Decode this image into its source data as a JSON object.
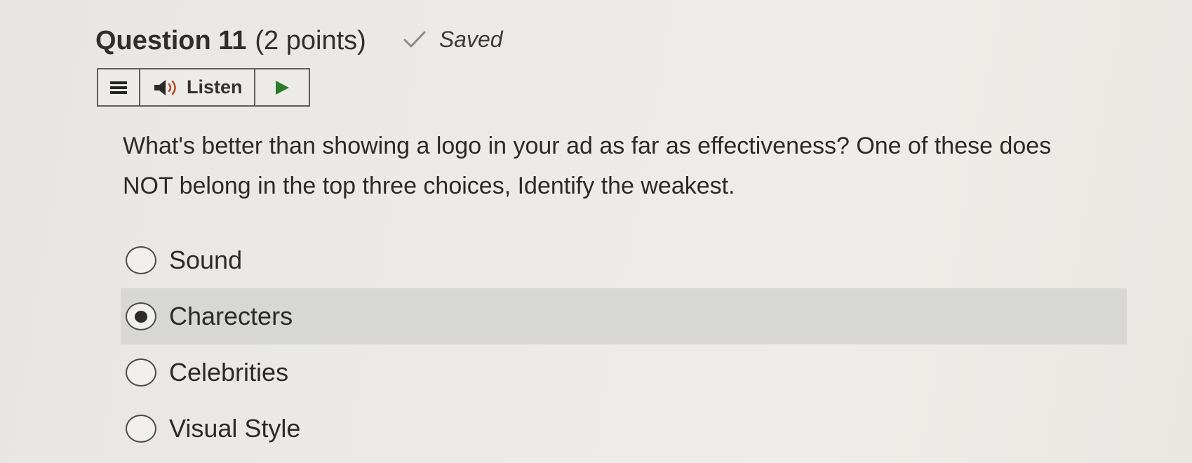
{
  "question": {
    "title": "Question 11",
    "points": "(2 points)",
    "status": "Saved",
    "status_icon": "check-icon",
    "text": "What's better than showing a logo in your ad as far as effectiveness? One of these does NOT belong in the top three choices, Identify the weakest."
  },
  "toolbar": {
    "menu_icon": "menu-icon",
    "listen_icon": "speaker-icon",
    "listen_label": "Listen",
    "play_icon": "play-icon"
  },
  "options": [
    {
      "label": "Sound",
      "selected": false
    },
    {
      "label": "Charecters",
      "selected": true
    },
    {
      "label": "Celebrities",
      "selected": false
    },
    {
      "label": "Visual Style",
      "selected": false
    }
  ],
  "colors": {
    "selected_row": "#d7d7d5",
    "border": "#5e5e5e"
  }
}
